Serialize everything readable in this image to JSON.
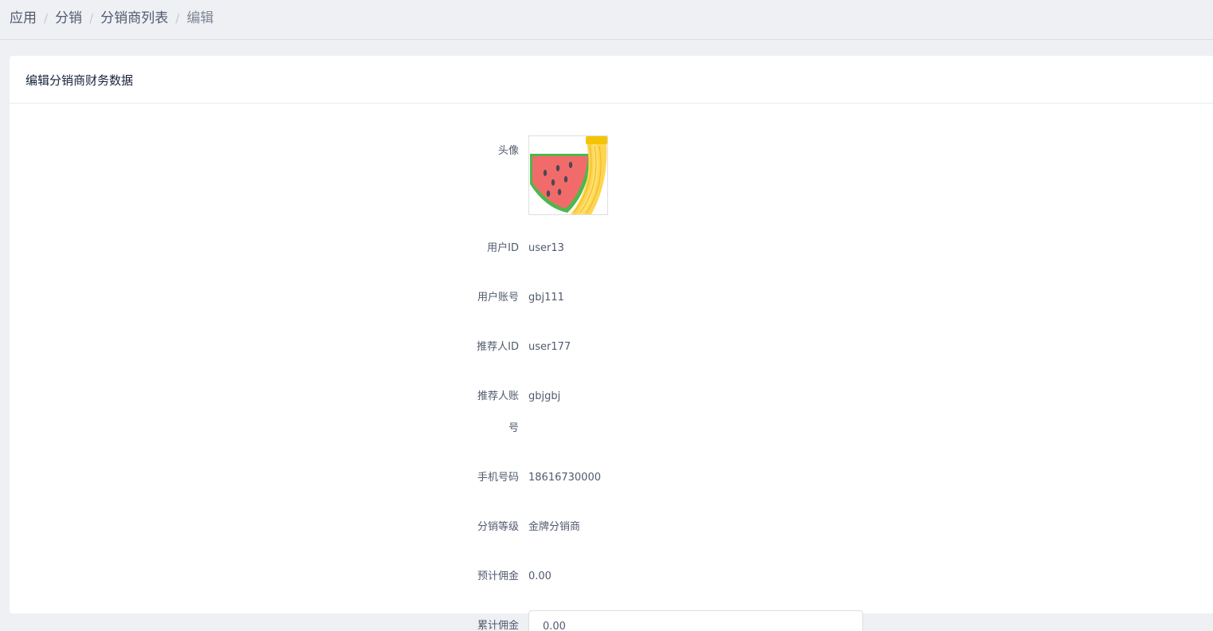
{
  "breadcrumb": {
    "items": [
      "应用",
      "分销",
      "分销商列表",
      "编辑"
    ],
    "separator": "/"
  },
  "card": {
    "title": "编辑分销商财务数据"
  },
  "form": {
    "avatar_label": "头像",
    "user_id_label": "用户ID",
    "user_id_value": "user13",
    "account_label": "用户账号",
    "account_value": "gbj111",
    "referrer_id_label": "推荐人ID",
    "referrer_id_value": "user177",
    "referrer_account_label": "推荐人账号",
    "referrer_account_value": "gbjgbj",
    "phone_label": "手机号码",
    "phone_value": "18616730000",
    "level_label": "分销等级",
    "level_value": "金牌分销商",
    "expected_commission_label": "预计佣金",
    "expected_commission_value": "0.00",
    "total_commission_label": "累计佣金",
    "total_commission_value": "0.00"
  },
  "icons": {
    "avatar_image": "watermelon-banana-illustration"
  }
}
